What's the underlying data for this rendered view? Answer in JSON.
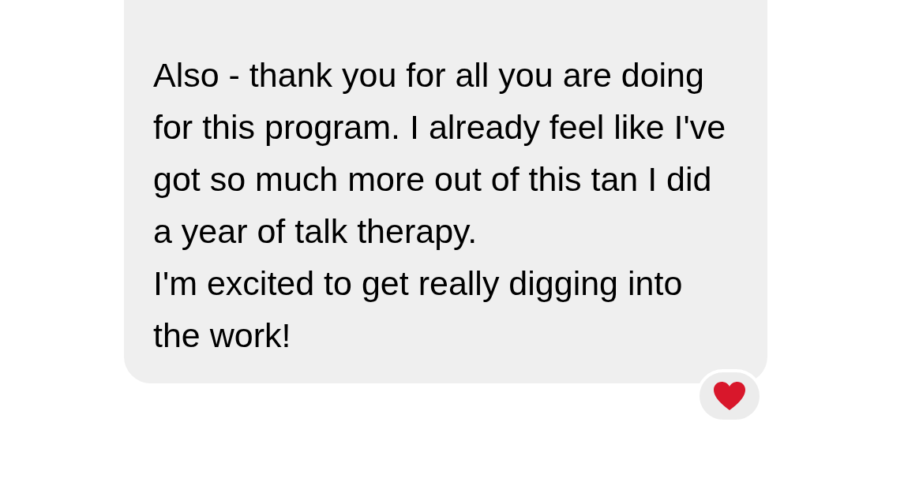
{
  "message": {
    "paragraphs": [
      "Also - thank you for all you are doing for this program. I already feel like I've got so much more out of this tan I did a year of talk therapy.",
      "I'm excited to get really digging into the work!"
    ]
  },
  "reaction": {
    "kind": "heart"
  }
}
